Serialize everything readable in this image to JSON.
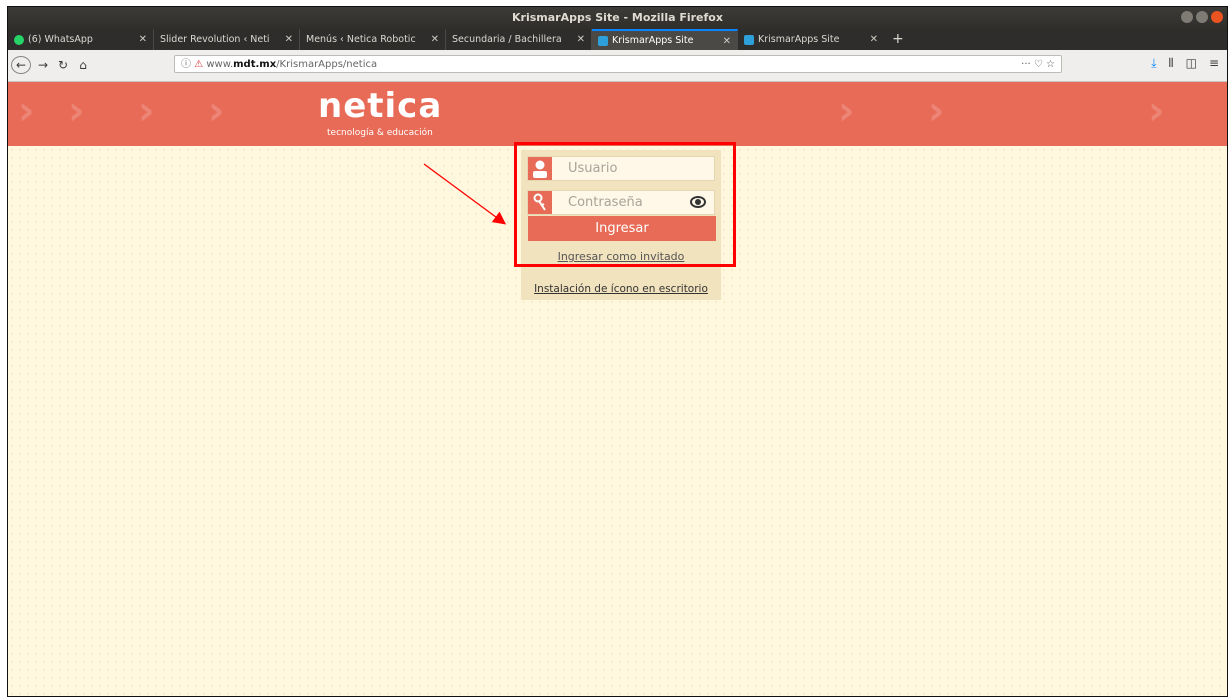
{
  "window": {
    "title": "KrismarApps Site - Mozilla Firefox"
  },
  "tabs": [
    {
      "label": "(6) WhatsApp",
      "icon": "whatsapp-icon"
    },
    {
      "label": "Slider Revolution ‹ Netica Ro",
      "icon": "none"
    },
    {
      "label": "Menús ‹ Netica Robotics —",
      "icon": "none"
    },
    {
      "label": "Secundaria / Bachillerato - N",
      "icon": "none"
    },
    {
      "label": "KrismarApps Site",
      "icon": "site-icon",
      "active": true
    },
    {
      "label": "KrismarApps Site",
      "icon": "site-icon"
    }
  ],
  "nav": {
    "url_prefix": "www.",
    "url_domain": "mdt.mx",
    "url_path": "/KrismarApps/netica",
    "url_icons": "··· ♡ ☆"
  },
  "header": {
    "logo": "netica",
    "tagline": "tecnología & educación",
    "accent_color": "#e86b57"
  },
  "login": {
    "user_placeholder": "Usuario",
    "password_placeholder": "Contraseña",
    "submit_label": "Ingresar",
    "guest_label": "Ingresar como invitado",
    "install_label": "Instalación de ícono en escritorio"
  }
}
